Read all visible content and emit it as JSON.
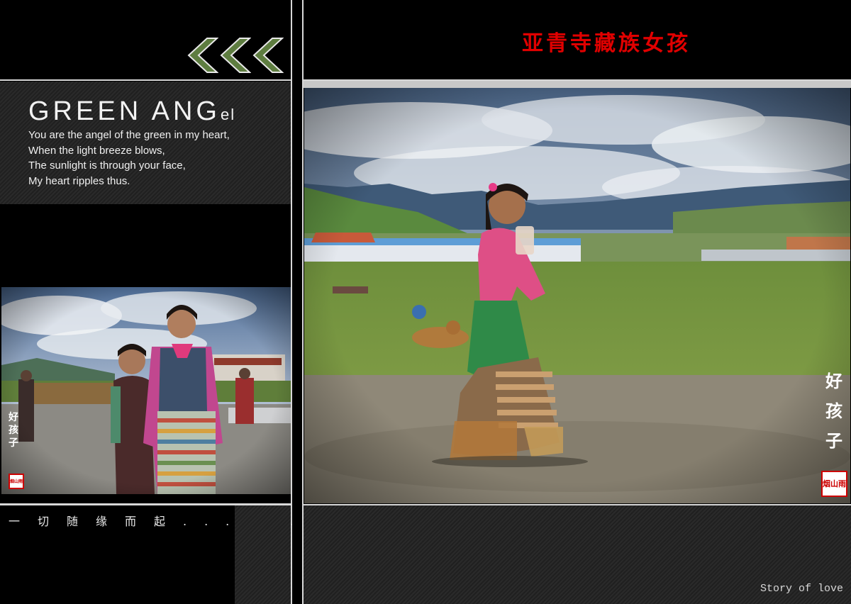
{
  "header": {
    "title_cn": "亚青寺藏族女孩"
  },
  "left_panel": {
    "title_main": "GREEN ANG",
    "title_tail": "el",
    "poem_lines": [
      "You are the angel of the green in my heart,",
      "When the light breeze blows,",
      "The sunlight is through your face,",
      "My heart ripples thus."
    ],
    "bottom_caption": "一切随缘而起......"
  },
  "photo_small": {
    "vertical_label": [
      "好",
      "孩",
      "子"
    ],
    "seal_text": "烟山雨"
  },
  "photo_big": {
    "vertical_label": [
      "好",
      "孩",
      "子"
    ],
    "seal_text": "烟山雨"
  },
  "footer": {
    "story_text": "Story of love"
  },
  "decor": {
    "chevron_icon": "triple-chevron-left-icon",
    "accent_red": "#e00000",
    "chevron_green": "#6f8f4a",
    "chevron_count": 3
  }
}
